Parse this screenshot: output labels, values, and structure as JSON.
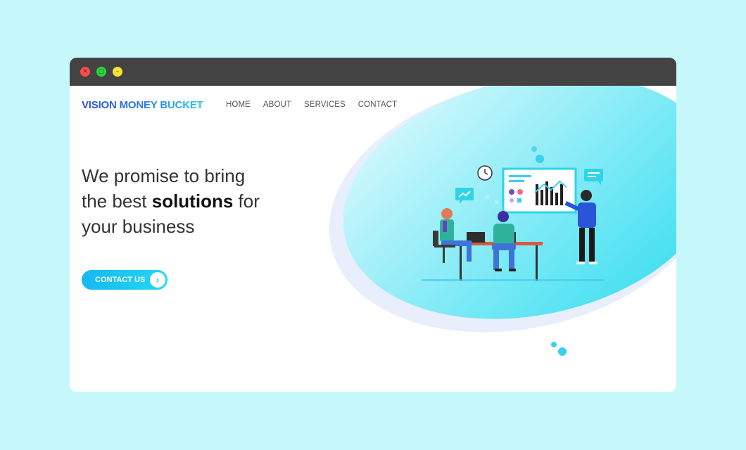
{
  "window": {
    "controls": [
      {
        "name": "close",
        "glyph": "✕"
      },
      {
        "name": "maximize",
        "glyph": "▢"
      },
      {
        "name": "minimize",
        "glyph": "–"
      }
    ]
  },
  "brand": "VISION MONEY BUCKET",
  "nav": {
    "items": [
      "HOME",
      "ABOUT",
      "SERVICES",
      "CONTACT"
    ]
  },
  "hero": {
    "line1": "We promise to bring",
    "line2_pre": "the best ",
    "line2_bold": "solutions",
    "line2_post": " for",
    "line3": "your business"
  },
  "cta": {
    "label": "CONTACT US",
    "icon": "chevron-right-icon",
    "glyph": "›"
  },
  "colors": {
    "page_background": "#c6f8fb",
    "titlebar": "#434343",
    "accent": "#1bc4ee",
    "brand_start": "#2b50d6",
    "brand_end": "#24c8f0"
  }
}
